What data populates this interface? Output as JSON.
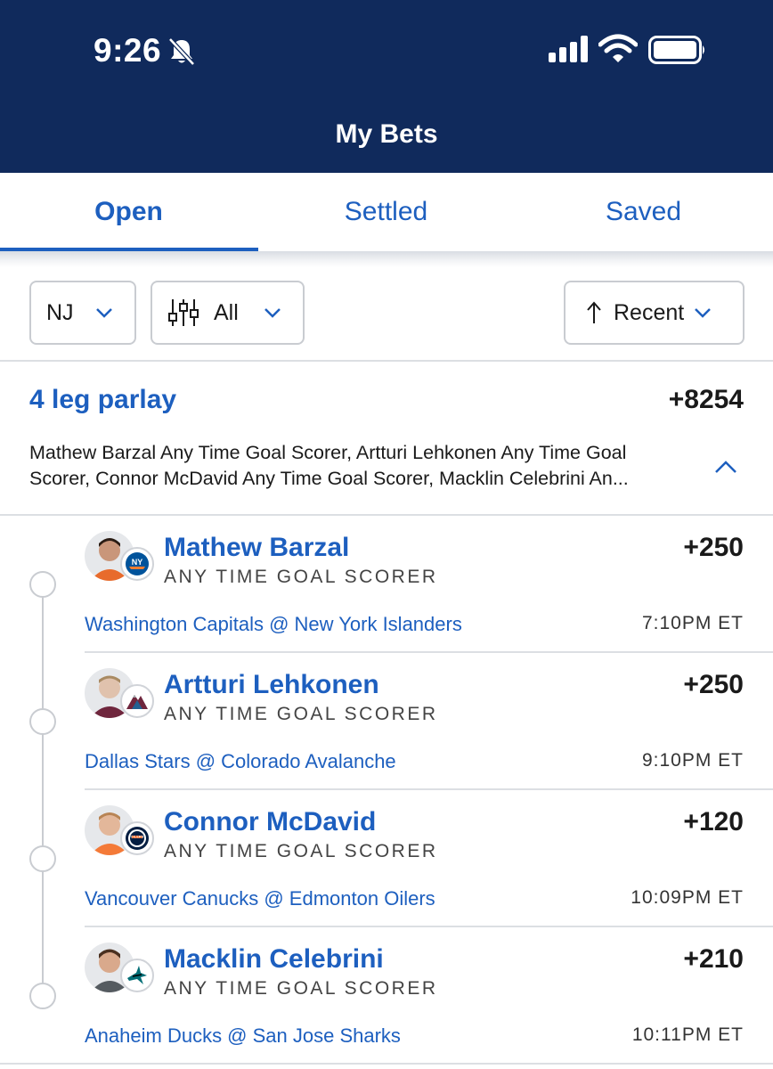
{
  "status_bar": {
    "time": "9:26"
  },
  "header": {
    "title": "My Bets"
  },
  "tabs": [
    {
      "label": "Open",
      "active": true
    },
    {
      "label": "Settled",
      "active": false
    },
    {
      "label": "Saved",
      "active": false
    }
  ],
  "filters": {
    "state": "NJ",
    "sport": "All",
    "sort": "Recent"
  },
  "parlay": {
    "title": "4 leg parlay",
    "odds": "+8254",
    "description_line1": "Mathew Barzal Any Time Goal Scorer, Artturi Lehkonen Any Time Goal",
    "description_line2": "Scorer, Connor McDavid Any Time Goal Scorer, Macklin Celebrini An..."
  },
  "legs": [
    {
      "player": "Mathew Barzal",
      "market": "ANY TIME GOAL SCORER",
      "odds": "+250",
      "matchup": "Washington Capitals @ New York Islanders",
      "time": "7:10PM ET",
      "team_logo": "islanders-logo"
    },
    {
      "player": "Artturi Lehkonen",
      "market": "ANY TIME GOAL SCORER",
      "odds": "+250",
      "matchup": "Dallas Stars @ Colorado Avalanche",
      "time": "9:10PM ET",
      "team_logo": "avalanche-logo"
    },
    {
      "player": "Connor McDavid",
      "market": "ANY TIME GOAL SCORER",
      "odds": "+120",
      "matchup": "Vancouver Canucks @ Edmonton Oilers",
      "time": "10:09PM ET",
      "team_logo": "oilers-logo"
    },
    {
      "player": "Macklin Celebrini",
      "market": "ANY TIME GOAL SCORER",
      "odds": "+210",
      "matchup": "Anaheim Ducks @ San Jose Sharks",
      "time": "10:11PM ET",
      "team_logo": "sharks-logo"
    }
  ],
  "colors": {
    "header_bg": "#102a5c",
    "accent": "#1d5fbf"
  }
}
